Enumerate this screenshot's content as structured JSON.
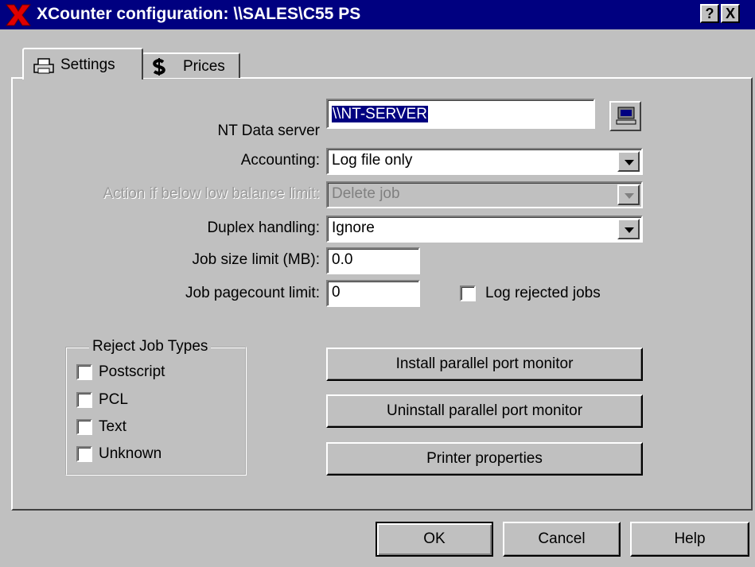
{
  "window": {
    "title": "XCounter configuration: \\\\SALES\\C55 PS",
    "help_btn": "?",
    "close_btn": "X"
  },
  "tabs": [
    {
      "label": "Settings",
      "icon": "printer-icon"
    },
    {
      "label": "Prices",
      "icon": "dollar-icon"
    }
  ],
  "form": {
    "nt_server": {
      "label": "NT Data server",
      "value": "\\\\NT-SERVER"
    },
    "accounting": {
      "label": "Accounting:",
      "value": "Log file only"
    },
    "low_balance": {
      "label": "Action if below low balance limit:",
      "value": "Delete job"
    },
    "duplex": {
      "label": "Duplex handling:",
      "value": "Ignore"
    },
    "job_size": {
      "label": "Job size limit (MB):",
      "value": "0.0"
    },
    "pagecount": {
      "label": "Job pagecount limit:",
      "value": "0"
    },
    "log_rejected": {
      "label": "Log rejected jobs",
      "checked": false
    }
  },
  "reject_group": {
    "title": "Reject Job Types",
    "items": [
      {
        "label": "Postscript",
        "checked": false
      },
      {
        "label": "PCL",
        "checked": false
      },
      {
        "label": "Text",
        "checked": false
      },
      {
        "label": "Unknown",
        "checked": false
      }
    ]
  },
  "actions": {
    "install": "Install parallel port monitor",
    "uninstall": "Uninstall parallel port monitor",
    "printer_props": "Printer properties"
  },
  "footer": {
    "ok": "OK",
    "cancel": "Cancel",
    "help": "Help"
  }
}
